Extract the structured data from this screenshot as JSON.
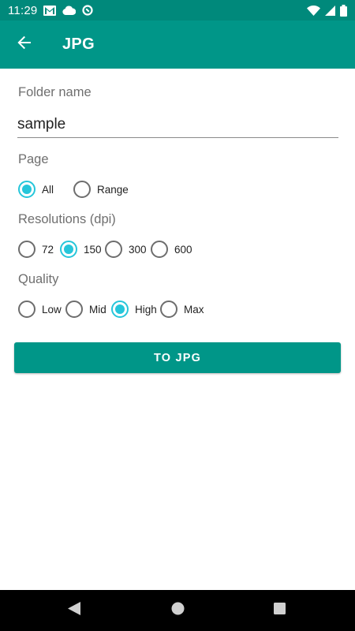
{
  "status_bar": {
    "time": "11:29",
    "left_icons": [
      "gmail-icon",
      "cloud-icon",
      "data-saver-icon"
    ],
    "right_icons": [
      "wifi-icon",
      "signal-icon",
      "battery-icon"
    ]
  },
  "app_bar": {
    "title": "JPG",
    "back_icon": "arrow-back-icon",
    "color": "#009688"
  },
  "folder": {
    "label": "Folder name",
    "value": "sample"
  },
  "page": {
    "label": "Page",
    "options": [
      {
        "label": "All",
        "checked": true
      },
      {
        "label": "Range",
        "checked": false
      }
    ]
  },
  "resolution": {
    "label": "Resolutions (dpi)",
    "options": [
      {
        "label": "72",
        "checked": false
      },
      {
        "label": "150",
        "checked": true
      },
      {
        "label": "300",
        "checked": false
      },
      {
        "label": "600",
        "checked": false
      }
    ]
  },
  "quality": {
    "label": "Quality",
    "options": [
      {
        "label": "Low",
        "checked": false
      },
      {
        "label": "Mid",
        "checked": false
      },
      {
        "label": "High",
        "checked": true
      },
      {
        "label": "Max",
        "checked": false
      }
    ]
  },
  "action": {
    "label": "TO JPG"
  },
  "colors": {
    "accent": "#26c6da",
    "primary": "#009688",
    "primary_dark": "#00897b"
  },
  "nav_bar": {
    "icons": [
      "back-triangle-icon",
      "home-circle-icon",
      "recents-square-icon"
    ]
  }
}
